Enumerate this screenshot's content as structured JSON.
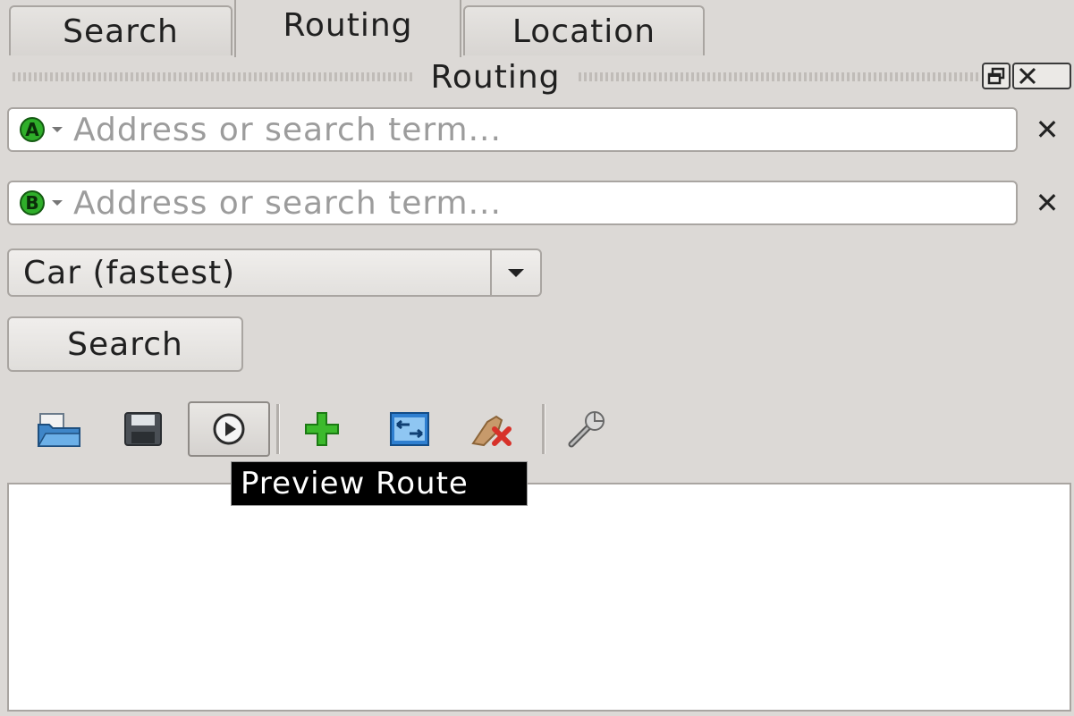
{
  "tabs": [
    {
      "label": "Search",
      "active": false
    },
    {
      "label": "Routing",
      "active": true
    },
    {
      "label": "Location",
      "active": false
    }
  ],
  "dock": {
    "title": "Routing",
    "float_icon": "float-window-icon",
    "close_icon": "close-icon"
  },
  "route": {
    "from": {
      "marker": "A",
      "value": "",
      "placeholder": "Address or search term..."
    },
    "to": {
      "marker": "B",
      "value": "",
      "placeholder": "Address or search term..."
    },
    "clear_icon": "clear-x-icon"
  },
  "profile": {
    "selected": "Car (fastest)"
  },
  "search_button": "Search",
  "toolbar": {
    "items": [
      {
        "name": "open-route-icon"
      },
      {
        "name": "save-route-icon"
      },
      {
        "name": "preview-route-icon"
      },
      {
        "name": "add-via-point-icon"
      },
      {
        "name": "reverse-route-icon"
      },
      {
        "name": "clear-route-icon"
      },
      {
        "name": "settings-wrench-icon"
      }
    ]
  },
  "tooltip": "Preview Route",
  "colors": {
    "background": "#dcd9d6",
    "marker_green": "#2fae2a",
    "tooltip_bg": "#000000"
  }
}
